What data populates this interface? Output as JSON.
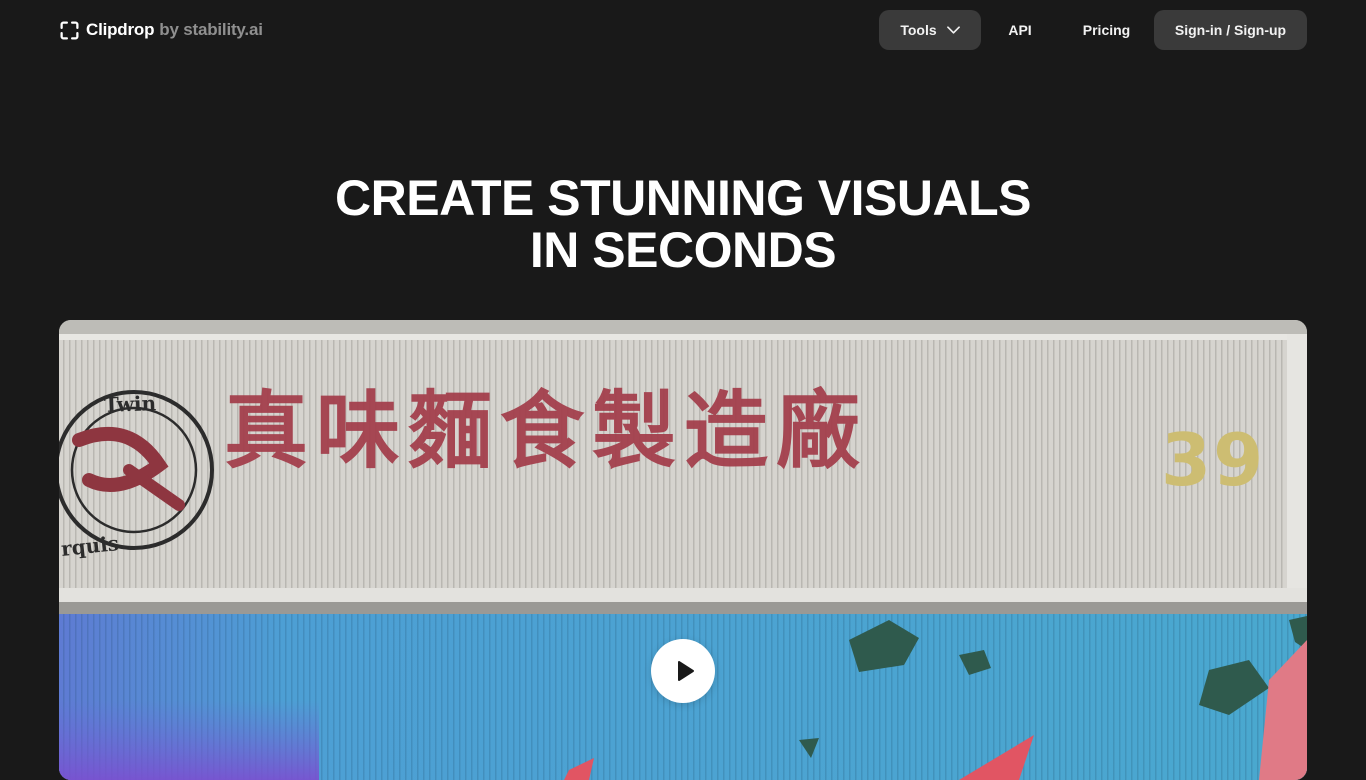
{
  "header": {
    "brand_name": "Clipdrop",
    "brand_by": "by stability.ai",
    "nav": {
      "tools_label": "Tools",
      "api_label": "API",
      "pricing_label": "Pricing",
      "signin_label": "Sign-in / Sign-up"
    }
  },
  "hero": {
    "title_line1": "CREATE STUNNING VISUALS",
    "title_line2": "IN SECONDS"
  },
  "video": {
    "sign_text": "真味麵食製造廠",
    "sign_number": "39",
    "stamp_top": "Twin",
    "stamp_bottom": "rquis"
  },
  "colors": {
    "background": "#191919",
    "nav_button_bg": "#3a3a3a",
    "text": "#ffffff",
    "brand_by": "#8f8f8f",
    "sign_red": "#a33c49",
    "sign_number_gold": "#cdbd72",
    "mural_blue": "#4aa8cf"
  },
  "icons": {
    "logo": "crop-frame-icon",
    "tools_dropdown": "chevron-down-icon",
    "play": "play-icon"
  }
}
